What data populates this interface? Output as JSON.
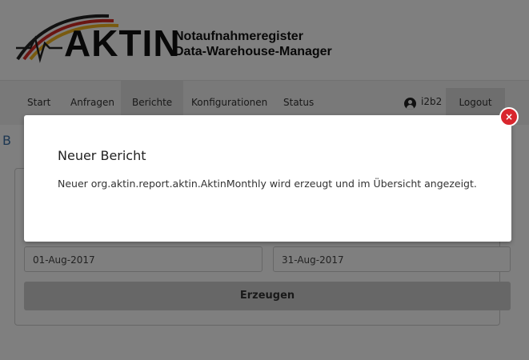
{
  "header": {
    "logo_text": "AKTIN",
    "title_line1": "Notaufnahmeregister",
    "title_line2": "Data-Warehouse-Manager"
  },
  "nav": {
    "items": [
      {
        "label": "Start"
      },
      {
        "label": "Anfragen"
      },
      {
        "label": "Berichte",
        "active": true
      },
      {
        "label": "Konfigurationen"
      },
      {
        "label": "Status"
      }
    ],
    "user": "i2b2",
    "logout_label": "Logout"
  },
  "page": {
    "section_letter": "B",
    "start_date": "01-Aug-2017",
    "end_date": "31-Aug-2017",
    "generate_label": "Erzeugen"
  },
  "modal": {
    "title": "Neuer Bericht",
    "message": "Neuer org.aktin.report.aktin.AktinMonthly wird erzeugt und im Übersicht angezeigt.",
    "close_glyph": "×"
  },
  "colors": {
    "accent_blue": "#3a6ea5",
    "close_red": "#d9262d",
    "flag_red": "#d42a25",
    "flag_gold": "#f2b51e"
  }
}
